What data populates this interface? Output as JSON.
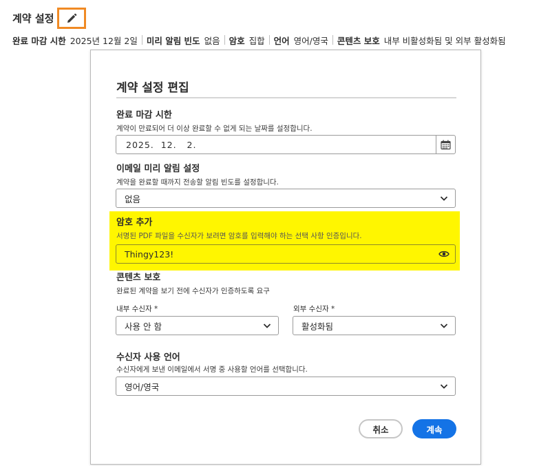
{
  "header": {
    "title": "계약 설정",
    "edit_icon": "pencil-icon"
  },
  "summary": [
    {
      "key": "완료 마감 시한",
      "value": "2025년 12월 2일"
    },
    {
      "key": "미리 알림 빈도",
      "value": "없음"
    },
    {
      "key": "암호",
      "value": "집합"
    },
    {
      "key": "언어",
      "value": "영어/영국"
    },
    {
      "key": "콘텐츠 보호",
      "value": "내부 비활성화됨 및 외부 활성화됨"
    }
  ],
  "dialog": {
    "title": "계약 설정 편집",
    "deadline": {
      "label": "완료 마감 시한",
      "desc": "계약이 만료되어 더 이상 완료할 수 없게 되는 날짜를 설정합니다.",
      "value": "2025.  12.   2.",
      "icon": "calendar-icon"
    },
    "reminder": {
      "label": "이메일 미리 알림 설정",
      "desc": "계약을 완료할 때까지 전송할 알림 빈도를 설정합니다.",
      "value": "없음"
    },
    "password": {
      "label": "암호 추가",
      "desc": "서명된 PDF 파일을 수신자가 보려면 암호를 입력해야 하는 선택 사항 인증입니다.",
      "value": "Thingy123!",
      "highlight_color": "#fff600"
    },
    "protection": {
      "label": "콘텐츠 보호",
      "desc": "완료된 계약을 보기 전에 수신자가 인증하도록 요구",
      "internal_label": "내부 수신자 *",
      "internal_value": "사용 안 함",
      "external_label": "외부 수신자 *",
      "external_value": "활성화됨"
    },
    "language": {
      "label": "수신자 사용 언어",
      "desc": "수신자에게 보낸 이메일에서 서명 중 사용할 언어를 선택합니다.",
      "value": "영어/영국"
    },
    "cancel_label": "취소",
    "continue_label": "계속",
    "accent_color": "#1473e6"
  }
}
